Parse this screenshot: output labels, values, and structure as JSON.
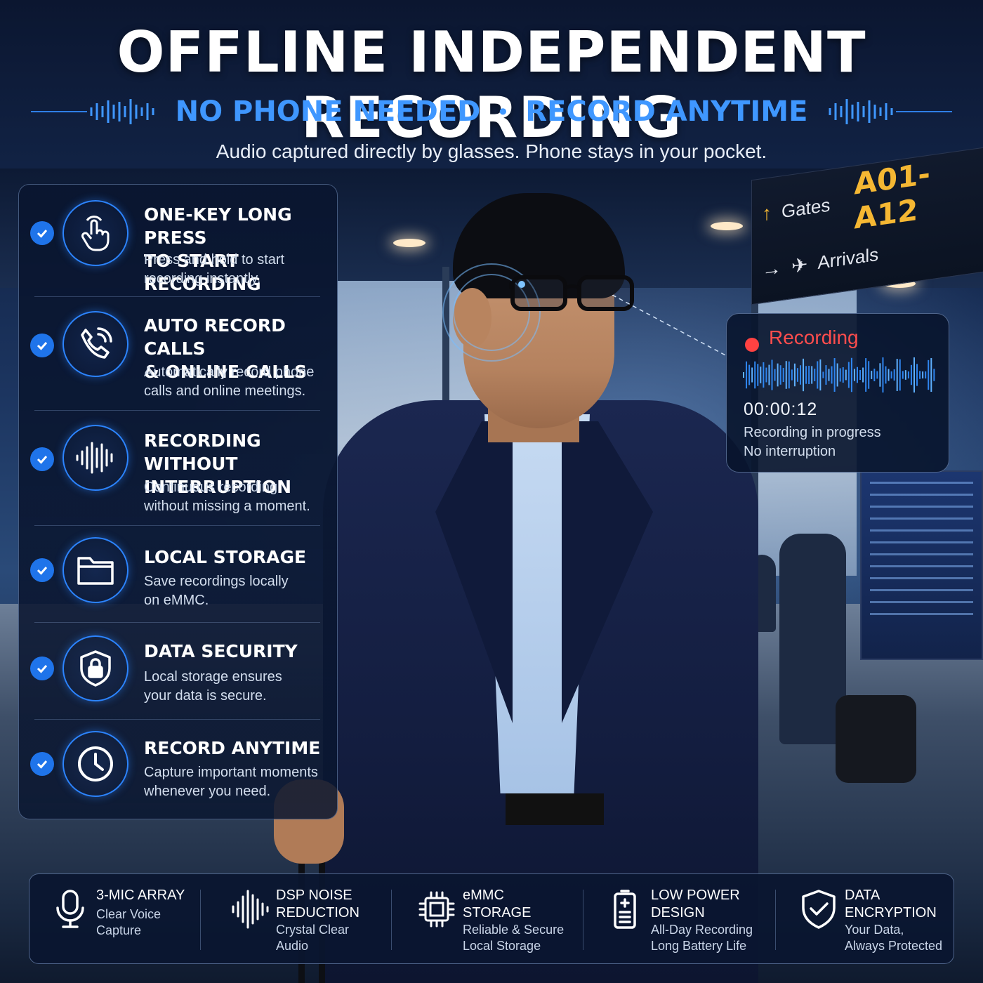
{
  "header": {
    "title": "OFFLINE INDEPENDENT RECORDING",
    "sub_left": "NO PHONE NEEDED",
    "sub_sep": "•",
    "sub_right": "RECORD ANYTIME",
    "tagline": "Audio captured directly by glasses. Phone stays in your pocket."
  },
  "features": [
    {
      "title_1": "ONE-KEY LONG PRESS",
      "title_2": "TO START RECORDING",
      "desc_1": "Press and hold to start",
      "desc_2": "recording instantly.",
      "icon": "hand-tap-icon"
    },
    {
      "title_1": "AUTO RECORD CALLS",
      "title_2": "& ONLINE CALLS",
      "desc_1": "Automatically record phone",
      "desc_2": "calls and online meetings.",
      "icon": "phone-call-icon"
    },
    {
      "title_1": "RECORDING WITHOUT",
      "title_2": "INTERRUPTION",
      "desc_1": "Continuous recording",
      "desc_2": "without missing a moment.",
      "icon": "soundwave-icon"
    },
    {
      "title_1": "LOCAL STORAGE",
      "title_2": "",
      "desc_1": "Save recordings locally",
      "desc_2": "on eMMC.",
      "icon": "folder-icon"
    },
    {
      "title_1": "DATA SECURITY",
      "title_2": "",
      "desc_1": "Local storage ensures",
      "desc_2": "your data is secure.",
      "icon": "shield-lock-icon"
    },
    {
      "title_1": "RECORD ANYTIME",
      "title_2": "",
      "desc_1": "Capture important moments",
      "desc_2": "whenever you need.",
      "icon": "clock-icon"
    }
  ],
  "recording_card": {
    "status": "Recording",
    "time": "00:00:12",
    "desc_1": "Recording in progress",
    "desc_2": "No interruption"
  },
  "sign": {
    "gates": "Gates",
    "code": "A01-A12",
    "arrivals": "Arrivals"
  },
  "specs": [
    {
      "title_1": "3-MIC ARRAY",
      "title_2": "",
      "desc_1": "Clear Voice",
      "desc_2": "Capture",
      "icon": "microphone-icon"
    },
    {
      "title_1": "DSP NOISE",
      "title_2": "REDUCTION",
      "desc_1": "Crystal Clear",
      "desc_2": "Audio",
      "icon": "soundwave-icon"
    },
    {
      "title_1": "eMMC",
      "title_2": "STORAGE",
      "desc_1": "Reliable & Secure",
      "desc_2": "Local Storage",
      "icon": "chip-icon"
    },
    {
      "title_1": "LOW POWER",
      "title_2": "DESIGN",
      "desc_1": "All-Day Recording",
      "desc_2": "Long Battery Life",
      "icon": "battery-icon"
    },
    {
      "title_1": "DATA",
      "title_2": "ENCRYPTION",
      "desc_1": "Your Data,",
      "desc_2": "Always Protected",
      "icon": "shield-check-icon"
    }
  ],
  "colors": {
    "accent_blue": "#3f97ff",
    "recording_red": "#ff4d4d",
    "sign_yellow": "#f5b733",
    "panel_bg": "#0a1630"
  }
}
